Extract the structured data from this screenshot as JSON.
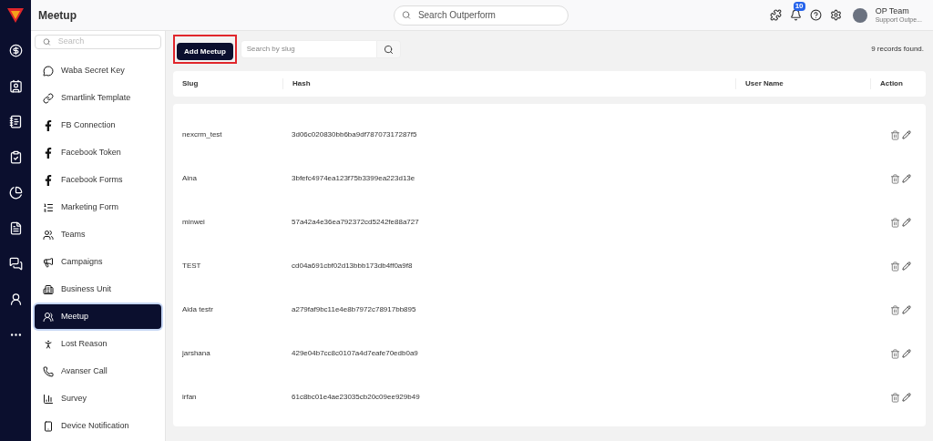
{
  "header": {
    "page_title": "Meetup",
    "search": {
      "placeholder": "Search Outperform"
    },
    "notifications_badge": "10",
    "user": {
      "name": "OP Team",
      "role": "Support Outpe..."
    }
  },
  "sidebar": {
    "search": {
      "placeholder": "Search"
    },
    "items": [
      {
        "label": "Waba Secret Key",
        "selected": false
      },
      {
        "label": "Smartlink Template",
        "selected": false
      },
      {
        "label": "FB Connection",
        "selected": false
      },
      {
        "label": "Facebook Token",
        "selected": false
      },
      {
        "label": "Facebook Forms",
        "selected": false
      },
      {
        "label": "Marketing Form",
        "selected": false
      },
      {
        "label": "Teams",
        "selected": false
      },
      {
        "label": "Campaigns",
        "selected": false
      },
      {
        "label": "Business Unit",
        "selected": false
      },
      {
        "label": "Meetup",
        "selected": true
      },
      {
        "label": "Lost Reason",
        "selected": false
      },
      {
        "label": "Avanser Call",
        "selected": false
      },
      {
        "label": "Survey",
        "selected": false
      },
      {
        "label": "Device Notification",
        "selected": false
      }
    ]
  },
  "toolbar": {
    "add_button": "Add Meetup",
    "search": {
      "placeholder": "Search by slug"
    },
    "records": "9 records found."
  },
  "table": {
    "columns": [
      "Slug",
      "Hash",
      "User Name",
      "Action"
    ],
    "rows": [
      {
        "slug": "nexcrm_test",
        "hash": "3d06c020830bb6ba9df78707317287f5"
      },
      {
        "slug": "Aina",
        "hash": "3bfefc4974ea123f75b3399ea223d13e"
      },
      {
        "slug": "minwei",
        "hash": "57a42a4e36ea792372cd5242fe88a727"
      },
      {
        "slug": "TEST",
        "hash": "cd04a691cbf02d13bbb173db4ff0a9f8"
      },
      {
        "slug": "Aida testr",
        "hash": "a279faf9bc11e4e8b7972c78917bb895"
      },
      {
        "slug": "jarshana",
        "hash": "429e04b7cc8c0107a4d7eafe70edb0a9"
      },
      {
        "slug": "irfan",
        "hash": "61c8bc01e4ae23035cb20c09ee929b49"
      }
    ]
  }
}
